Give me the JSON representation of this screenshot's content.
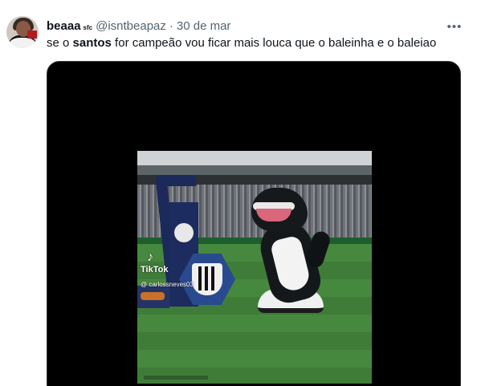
{
  "tweet": {
    "display_name": "beaaa",
    "badge": "sfc",
    "handle": "@isntbeapaz",
    "separator": "·",
    "date": "30 de mar",
    "more_icon": "more-horizontal-icon",
    "text_before": "se o ",
    "text_bold": "santos",
    "text_after": " for campeão vou ficar mais louca que o baleinha e o baleiao"
  },
  "media": {
    "type": "video",
    "watermark_brand": "TikTok",
    "watermark_user": "@ carlossneves03",
    "background_color": "#000000"
  },
  "colors": {
    "text_primary": "#0f1419",
    "text_secondary": "#536471",
    "background": "#ffffff"
  }
}
